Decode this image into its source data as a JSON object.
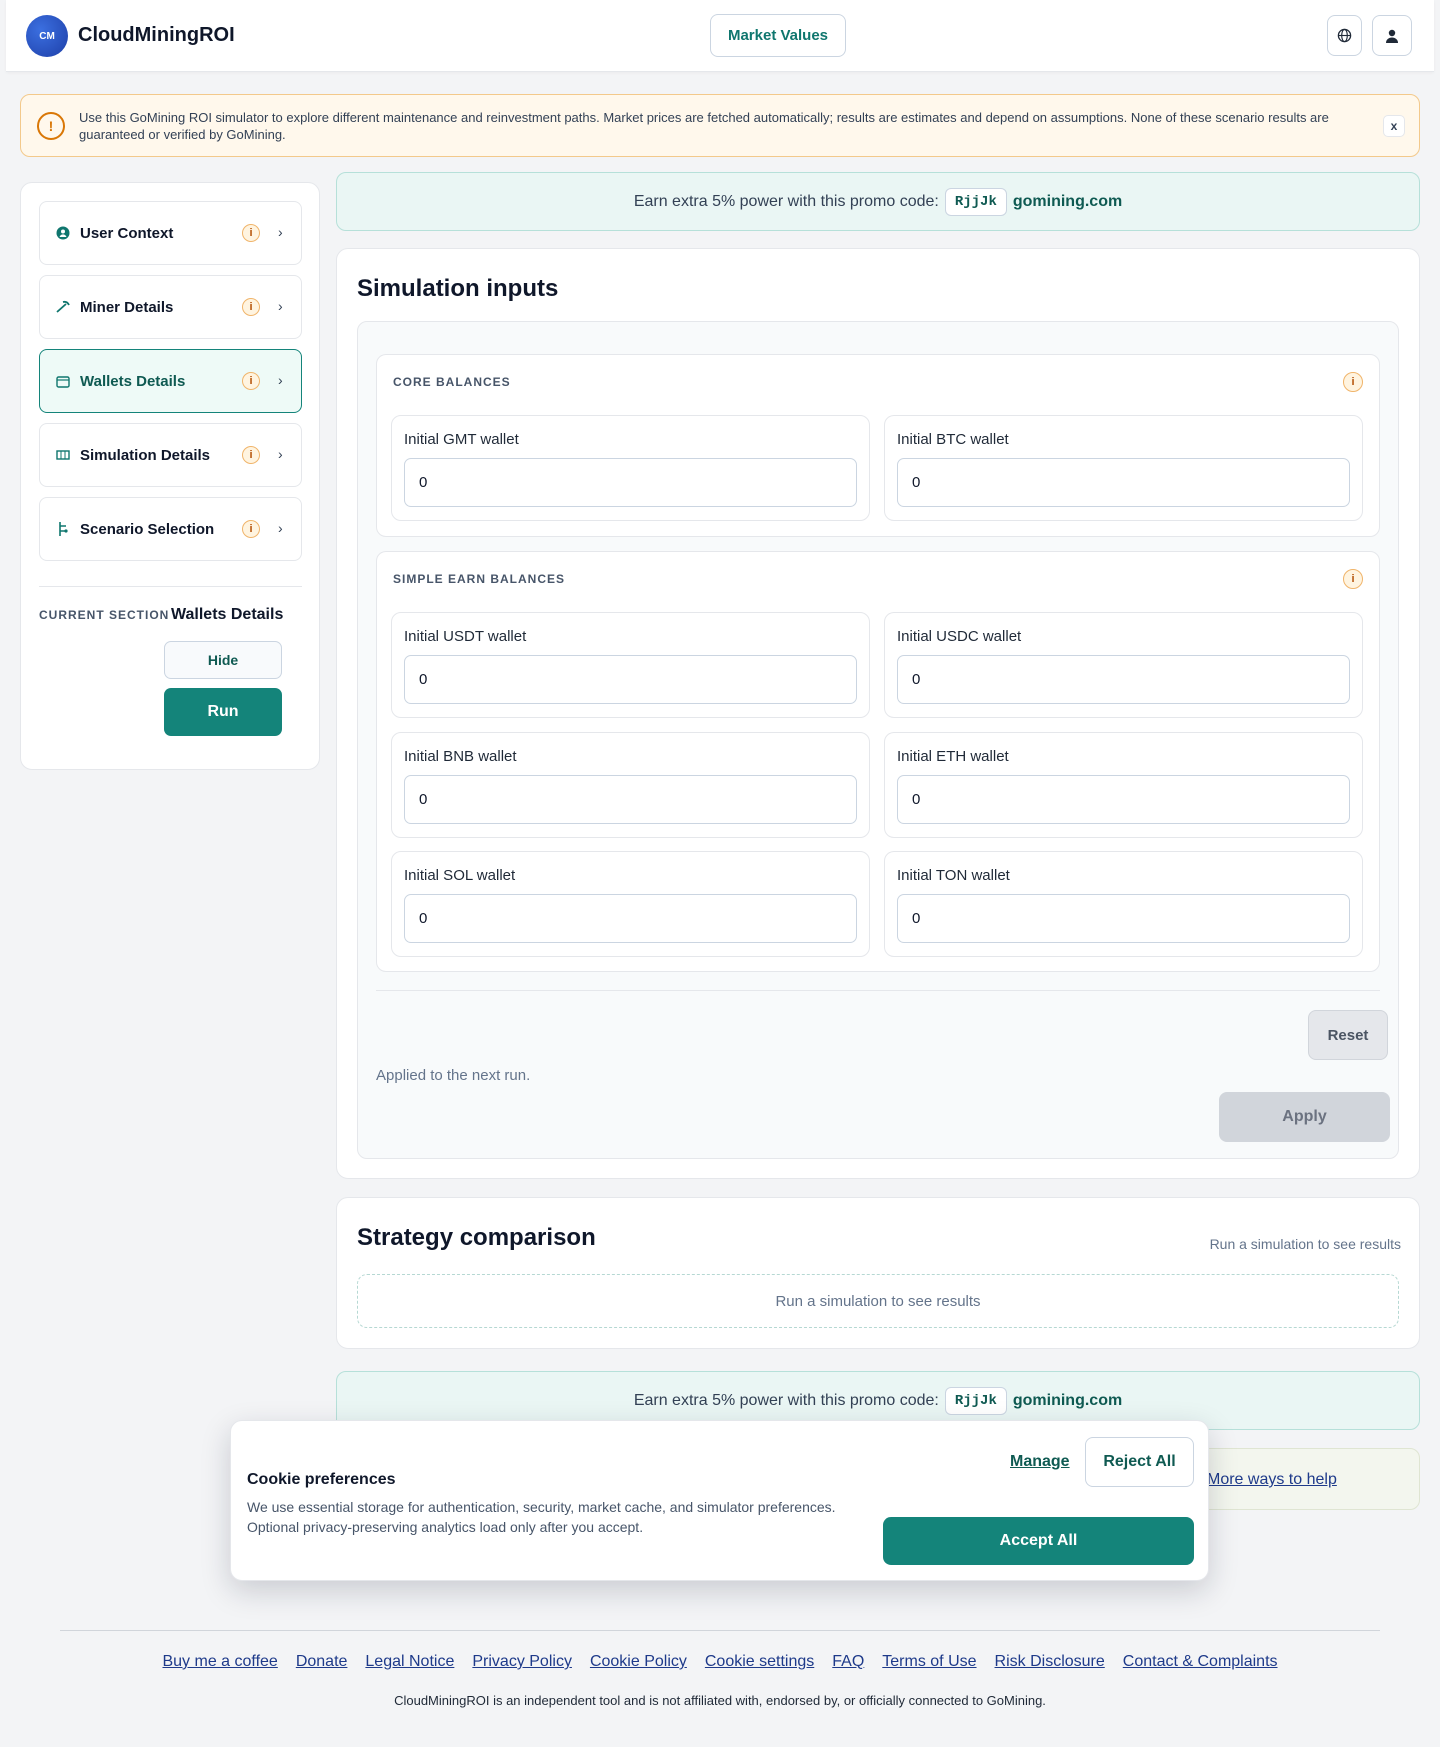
{
  "header": {
    "logo_text": "CM",
    "brand": "CloudMiningROI",
    "market_values": "Market Values",
    "globe_icon": "globe-icon",
    "user_icon": "user-icon"
  },
  "notice": {
    "icon": "!",
    "text": "Use this GoMining ROI simulator to explore different maintenance and reinvestment paths. Market prices are fetched automatically; results are estimates and depend on assumptions. None of these scenario results are guaranteed or verified by GoMining.",
    "close": "x"
  },
  "sidebar": {
    "items": [
      {
        "label": "User Context",
        "icon": "user-context-icon"
      },
      {
        "label": "Miner Details",
        "icon": "pickaxe-icon"
      },
      {
        "label": "Wallets Details",
        "icon": "wallet-icon"
      },
      {
        "label": "Simulation Details",
        "icon": "simulation-icon"
      },
      {
        "label": "Scenario Selection",
        "icon": "scenario-icon"
      }
    ],
    "info_glyph": "i",
    "chevron": "›",
    "current_section_label": "CURRENT SECTION",
    "current_section_value": "Wallets Details",
    "hide": "Hide",
    "run": "Run"
  },
  "promo": {
    "text": "Earn extra 5% power with this promo code:",
    "code": "RjjJk",
    "link": "gomining.com"
  },
  "simulation": {
    "title": "Simulation inputs",
    "core": {
      "title": "CORE BALANCES",
      "fields": [
        {
          "label": "Initial GMT wallet",
          "value": "0"
        },
        {
          "label": "Initial BTC wallet",
          "value": "0"
        }
      ]
    },
    "simple": {
      "title": "SIMPLE EARN BALANCES",
      "fields": [
        {
          "label": "Initial USDT wallet",
          "value": "0"
        },
        {
          "label": "Initial USDC wallet",
          "value": "0"
        },
        {
          "label": "Initial BNB wallet",
          "value": "0"
        },
        {
          "label": "Initial ETH wallet",
          "value": "0"
        },
        {
          "label": "Initial SOL wallet",
          "value": "0"
        },
        {
          "label": "Initial TON wallet",
          "value": "0"
        }
      ]
    },
    "reset": "Reset",
    "applied_note": "Applied to the next run.",
    "apply": "Apply"
  },
  "strategy": {
    "title": "Strategy comparison",
    "hint": "Run a simulation to see results",
    "empty": "Run a simulation to see results"
  },
  "help": {
    "link": "More ways to help"
  },
  "cookie": {
    "title": "Cookie preferences",
    "text": "We use essential storage for authentication, security, market cache, and simulator preferences. Optional privacy-preserving analytics load only after you accept.",
    "manage": "Manage",
    "reject": "Reject All",
    "accept": "Accept All"
  },
  "footer": {
    "links": [
      "Buy me a coffee",
      "Donate",
      "Legal Notice",
      "Privacy Policy",
      "Cookie Policy",
      "Cookie settings",
      "FAQ",
      "Terms of Use",
      "Risk Disclosure",
      "Contact & Complaints"
    ],
    "note": "CloudMiningROI is an independent tool and is not affiliated with, endorsed by, or officially connected to GoMining."
  },
  "colors": {
    "accent": "#14847a",
    "accent_dark": "#0f5a52",
    "warning": "#d97706",
    "link": "#1e3a8a"
  }
}
